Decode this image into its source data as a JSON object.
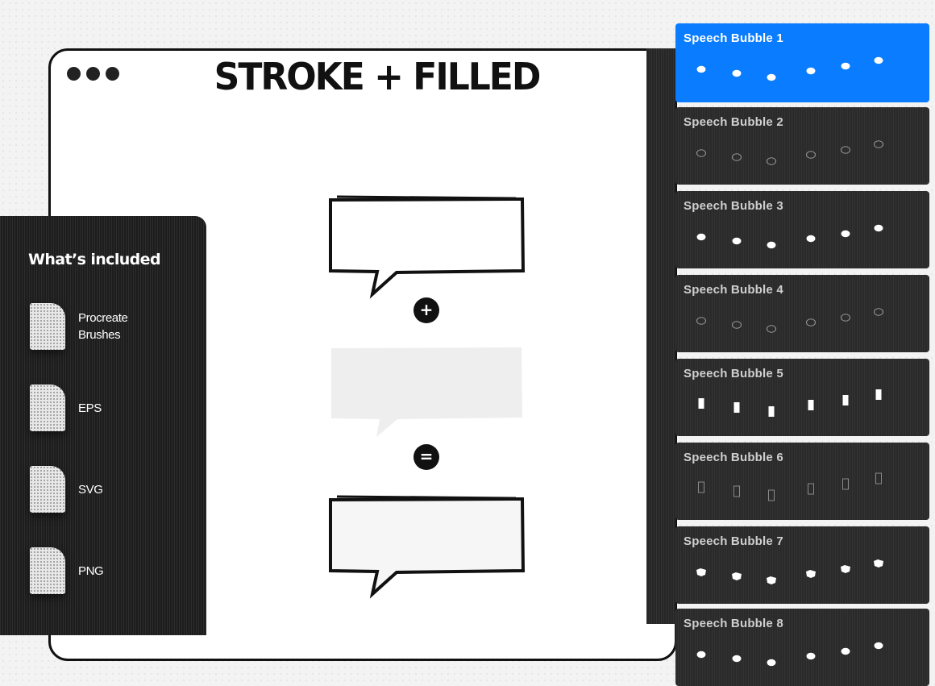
{
  "canvas": {
    "title": "STROKE + FILLED",
    "plus_symbol": "+",
    "equals_symbol": "=",
    "window_control_icons": [
      "dot",
      "dot",
      "dot"
    ]
  },
  "included": {
    "heading": "What’s included",
    "files": [
      {
        "label": "Procreate Brushes",
        "icon": "file-icon"
      },
      {
        "label": "EPS",
        "icon": "file-icon"
      },
      {
        "label": "SVG",
        "icon": "file-icon"
      },
      {
        "label": "PNG",
        "icon": "file-icon"
      }
    ]
  },
  "brushes": {
    "selected_index": 0,
    "accent_color": "#0a7cff",
    "items": [
      {
        "name": "Speech Bubble 1",
        "style": "filled-oval"
      },
      {
        "name": "Speech Bubble 2",
        "style": "outline-oval"
      },
      {
        "name": "Speech Bubble 3",
        "style": "filled-oval"
      },
      {
        "name": "Speech Bubble 4",
        "style": "outline-oval"
      },
      {
        "name": "Speech Bubble 5",
        "style": "filled-rect"
      },
      {
        "name": "Speech Bubble 6",
        "style": "outline-rect"
      },
      {
        "name": "Speech Bubble 7",
        "style": "filled-rough"
      },
      {
        "name": "Speech Bubble 8",
        "style": "filled-oval"
      }
    ]
  }
}
